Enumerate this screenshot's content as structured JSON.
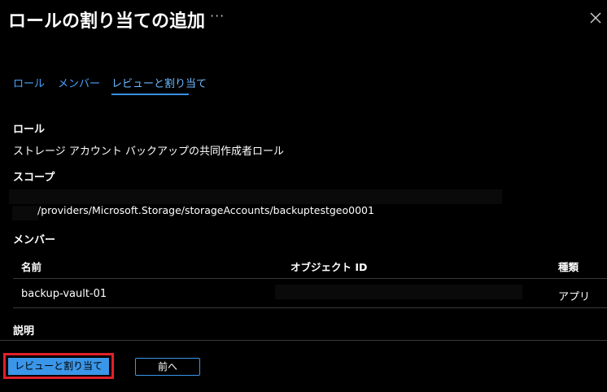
{
  "header": {
    "title": "ロールの割り当ての追加",
    "more_label": "···"
  },
  "tabs": [
    {
      "label": "ロール",
      "active": false
    },
    {
      "label": "メンバー",
      "active": false
    },
    {
      "label": "レビューと割り当て",
      "active": true
    }
  ],
  "role": {
    "label": "ロール",
    "value": "ストレージ アカウント バックアップの共同作成者ロール"
  },
  "scope": {
    "label": "スコープ",
    "path": "/providers/Microsoft.Storage/storageAccounts/backuptestgeo0001"
  },
  "members": {
    "label": "メンバー",
    "columns": [
      "名前",
      "オブジェクト ID",
      "種類"
    ],
    "rows": [
      {
        "name": "backup-vault-01",
        "object_id": "",
        "type": "アプリ"
      }
    ]
  },
  "description": {
    "label": "説明"
  },
  "footer": {
    "review_assign_label": "レビューと割り当て",
    "previous_label": "前へ"
  },
  "colors": {
    "background": "#000000",
    "link": "#4aa3ff",
    "primary_button": "#3a96e8",
    "highlight": "#e1202a"
  },
  "icons": [
    "close-icon",
    "more-icon"
  ]
}
